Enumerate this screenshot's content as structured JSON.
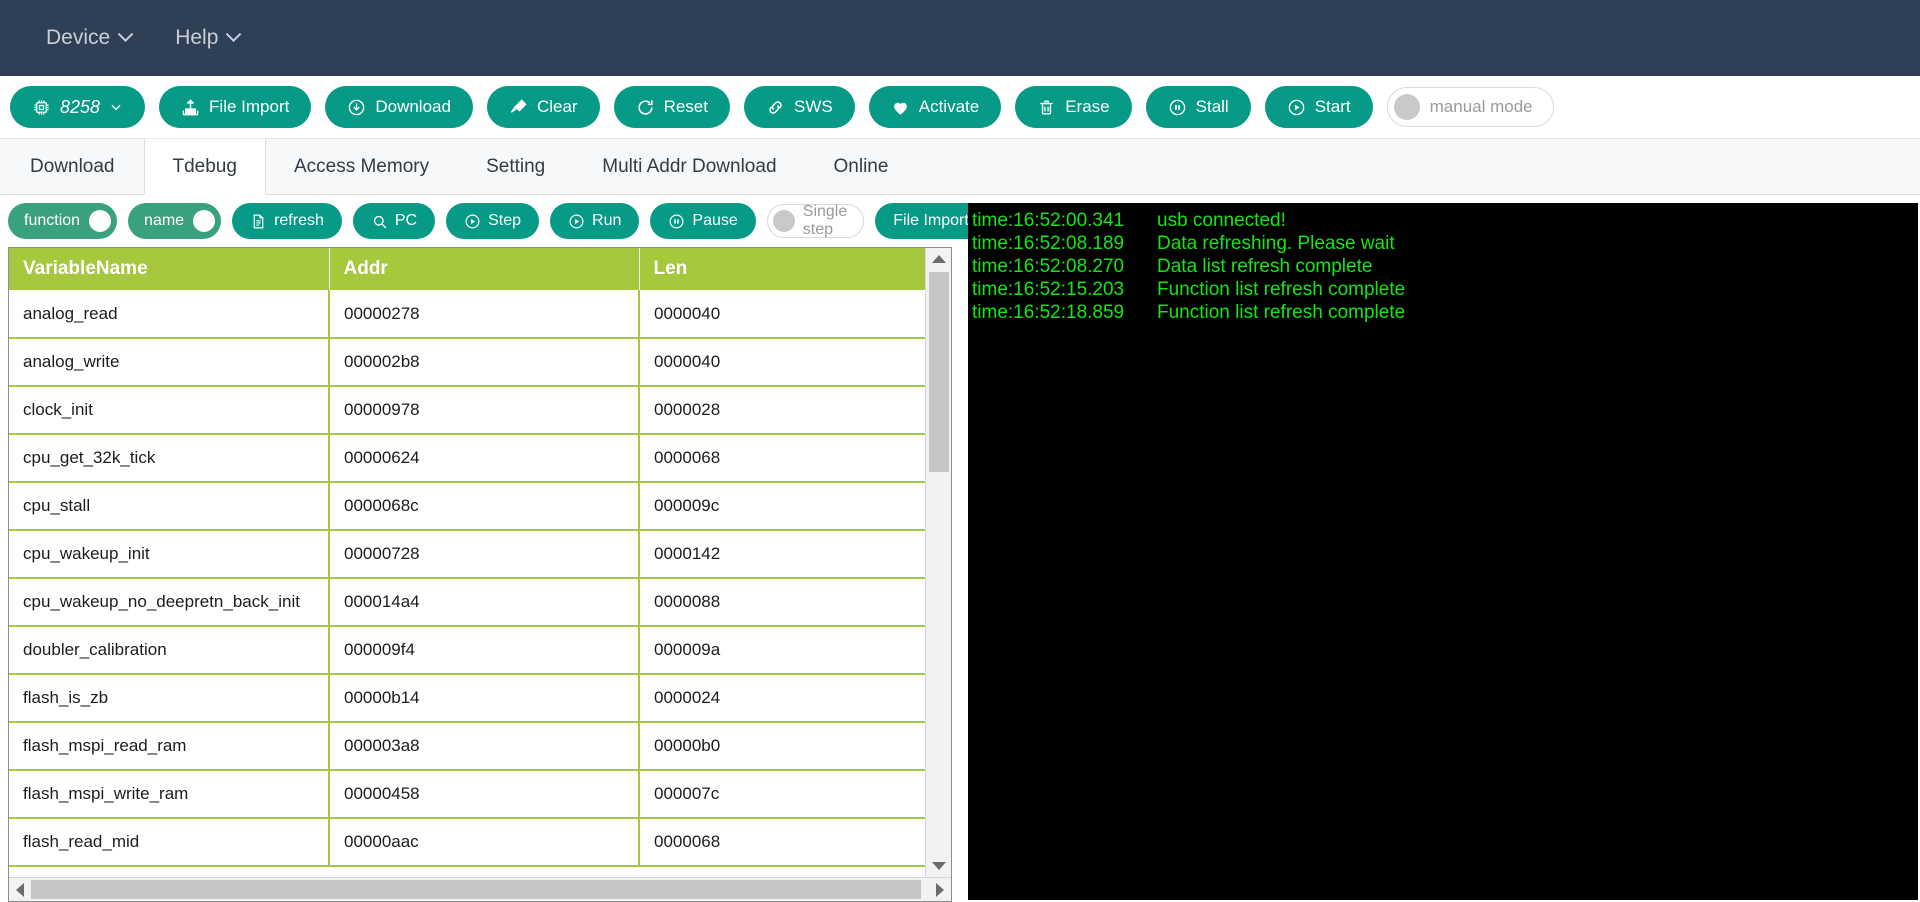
{
  "menubar": {
    "items": [
      {
        "label": "Device",
        "icon": "chevron-down-icon"
      },
      {
        "label": "Help",
        "icon": "chevron-down-icon"
      }
    ]
  },
  "toolbar": {
    "chip_select": {
      "label": "8258",
      "icon": "chip-icon",
      "caret": "chevron-down-icon"
    },
    "buttons": [
      {
        "label": "File Import",
        "icon": "upload-box-icon"
      },
      {
        "label": "Download",
        "icon": "download-circle-icon"
      },
      {
        "label": "Clear",
        "icon": "brush-icon"
      },
      {
        "label": "Reset",
        "icon": "refresh-icon"
      },
      {
        "label": "SWS",
        "icon": "link-icon"
      },
      {
        "label": "Activate",
        "icon": "heart-icon"
      },
      {
        "label": "Erase",
        "icon": "trash-icon"
      },
      {
        "label": "Stall",
        "icon": "pause-circle-icon"
      },
      {
        "label": "Start",
        "icon": "play-circle-icon"
      }
    ],
    "manual_mode": {
      "label": "manual mode",
      "state": "off"
    }
  },
  "tabs": {
    "items": [
      {
        "label": "Download",
        "active": false
      },
      {
        "label": "Tdebug",
        "active": true
      },
      {
        "label": "Access Memory",
        "active": false
      },
      {
        "label": "Setting",
        "active": false
      },
      {
        "label": "Multi Addr Download",
        "active": false
      },
      {
        "label": "Online",
        "active": false
      }
    ]
  },
  "subtoolbar": {
    "switches": [
      {
        "label": "function",
        "state": "on"
      },
      {
        "label": "name",
        "state": "on"
      }
    ],
    "buttons": [
      {
        "label": "refresh",
        "icon": "document-icon"
      },
      {
        "label": "PC",
        "icon": "magnifier-icon"
      },
      {
        "label": "Step",
        "icon": "play-circle-icon"
      },
      {
        "label": "Run",
        "icon": "play-circle-icon"
      },
      {
        "label": "Pause",
        "icon": "pause-circle-icon"
      }
    ],
    "single_step": {
      "label": "Single step",
      "state": "off"
    },
    "file_import": {
      "label": "File Import"
    }
  },
  "table": {
    "columns": [
      "VariableName",
      "Addr",
      "Len"
    ],
    "rows": [
      {
        "name": "analog_read",
        "addr": "00000278",
        "len": "0000040"
      },
      {
        "name": "analog_write",
        "addr": "000002b8",
        "len": "0000040"
      },
      {
        "name": "clock_init",
        "addr": "00000978",
        "len": "0000028"
      },
      {
        "name": "cpu_get_32k_tick",
        "addr": "00000624",
        "len": "0000068"
      },
      {
        "name": "cpu_stall",
        "addr": "0000068c",
        "len": "000009c"
      },
      {
        "name": "cpu_wakeup_init",
        "addr": "00000728",
        "len": "0000142"
      },
      {
        "name": "cpu_wakeup_no_deepretn_back_init",
        "addr": "000014a4",
        "len": "0000088"
      },
      {
        "name": "doubler_calibration",
        "addr": "000009f4",
        "len": "000009a"
      },
      {
        "name": "flash_is_zb",
        "addr": "00000b14",
        "len": "0000024"
      },
      {
        "name": "flash_mspi_read_ram",
        "addr": "000003a8",
        "len": "00000b0"
      },
      {
        "name": "flash_mspi_write_ram",
        "addr": "00000458",
        "len": "000007c"
      },
      {
        "name": "flash_read_mid",
        "addr": "00000aac",
        "len": "0000068"
      }
    ]
  },
  "console": {
    "lines": [
      {
        "ts": "time:16:52:00.341",
        "msg": "usb connected!"
      },
      {
        "ts": "time:16:52:08.189",
        "msg": "Data refreshing. Please wait"
      },
      {
        "ts": "time:16:52:08.270",
        "msg": "Data list refresh complete"
      },
      {
        "ts": "time:16:52:15.203",
        "msg": "Function list refresh complete"
      },
      {
        "ts": "time:16:52:18.859",
        "msg": "Function list refresh complete"
      }
    ]
  },
  "colors": {
    "menubar_bg": "#2f3f56",
    "accent_teal": "#069a87",
    "table_header_green": "#a5c83c",
    "console_text": "#14e614",
    "console_bg": "#000000"
  }
}
